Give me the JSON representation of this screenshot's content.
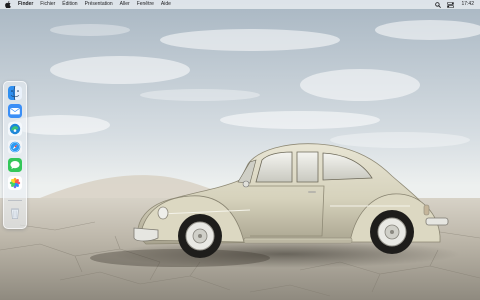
{
  "menubar": {
    "app_name": "Finder",
    "menus": [
      "Fichier",
      "Édition",
      "Présentation",
      "Aller",
      "Fenêtre",
      "Aide"
    ],
    "clock": "17:42"
  },
  "dock": {
    "items": [
      {
        "name": "finder",
        "icon": "finder-icon"
      },
      {
        "name": "mail",
        "icon": "mail-icon"
      },
      {
        "name": "edge",
        "icon": "edge-browser-icon"
      },
      {
        "name": "safari",
        "icon": "safari-icon"
      },
      {
        "name": "messages",
        "icon": "messages-icon"
      },
      {
        "name": "photos",
        "icon": "photos-icon"
      },
      {
        "name": "trash",
        "icon": "trash-icon"
      }
    ]
  },
  "wallpaper": {
    "subject": "vintage-beige-beetle-car-on-cracked-desert",
    "colors": {
      "sky_top": "#aebbc6",
      "sky_mid": "#d8dfe4",
      "horizon": "#eef0ee",
      "ground": "#b9b3a6",
      "car_body": "#ddd9c4"
    }
  }
}
